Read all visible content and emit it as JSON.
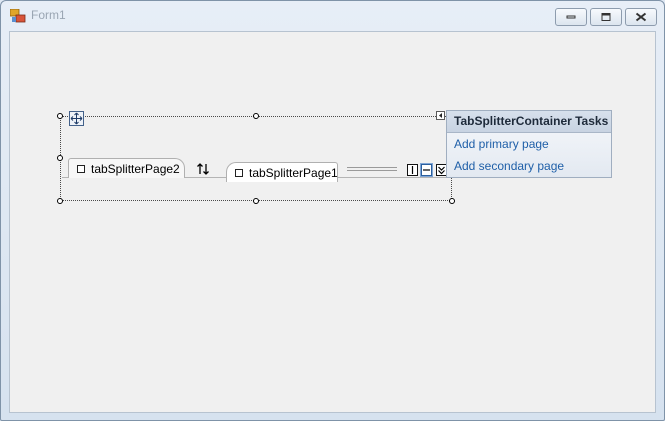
{
  "window": {
    "title": "Form1"
  },
  "tabs": {
    "secondary": "tabSplitterPage2",
    "primary": "tabSplitterPage1"
  },
  "tasks_panel": {
    "title": "TabSplitterContainer Tasks",
    "links": [
      "Add primary page",
      "Add secondary page"
    ]
  },
  "icons": {
    "app": "form-icon",
    "move": "move-icon",
    "smart_tag": "smart-tag-arrow-icon",
    "swap": "swap-arrows-icon",
    "layouts": [
      "vertical-split-icon",
      "horizontal-split-icon",
      "collapse-icon"
    ]
  },
  "colors": {
    "link": "#1f5fa8",
    "panel_header": "#c8d3e2",
    "client_background": "#f0f0f0"
  }
}
